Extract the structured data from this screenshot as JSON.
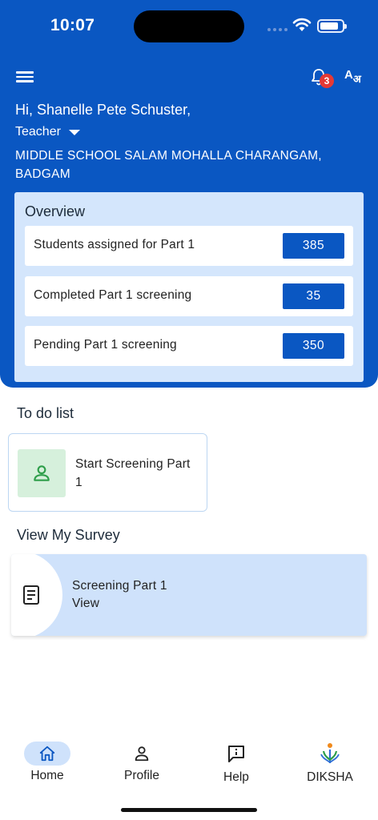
{
  "status": {
    "time": "10:07"
  },
  "header": {
    "notification_count": "3",
    "lang_icon_text": "A",
    "lang_icon_text2": "अ",
    "greeting": "Hi, Shanelle Pete Schuster,",
    "role": "Teacher",
    "school": "MIDDLE SCHOOL SALAM MOHALLA CHARANGAM, BADGAM"
  },
  "overview": {
    "title": "Overview",
    "rows": [
      {
        "label": "Students assigned for Part 1",
        "value": "385"
      },
      {
        "label": "Completed Part 1 screening",
        "value": "35"
      },
      {
        "label": "Pending Part 1 screening",
        "value": "350"
      }
    ]
  },
  "todo": {
    "title": "To do list",
    "items": [
      {
        "label": "Start Screening Part 1",
        "icon": "person-icon"
      }
    ]
  },
  "survey": {
    "title": "View My Survey",
    "items": [
      {
        "title": "Screening Part 1",
        "action": "View",
        "icon": "document-icon"
      }
    ]
  },
  "nav": {
    "items": [
      {
        "label": "Home",
        "icon": "home-icon",
        "active": true
      },
      {
        "label": "Profile",
        "icon": "profile-icon",
        "active": false
      },
      {
        "label": "Help",
        "icon": "help-icon",
        "active": false
      },
      {
        "label": "DIKSHA",
        "icon": "diksha-logo-icon",
        "active": false
      }
    ]
  },
  "colors": {
    "primary": "#0a57c2",
    "card_blue": "#d4e6fc",
    "badge_red": "#e53935",
    "todo_green": "#d6f0dc"
  }
}
